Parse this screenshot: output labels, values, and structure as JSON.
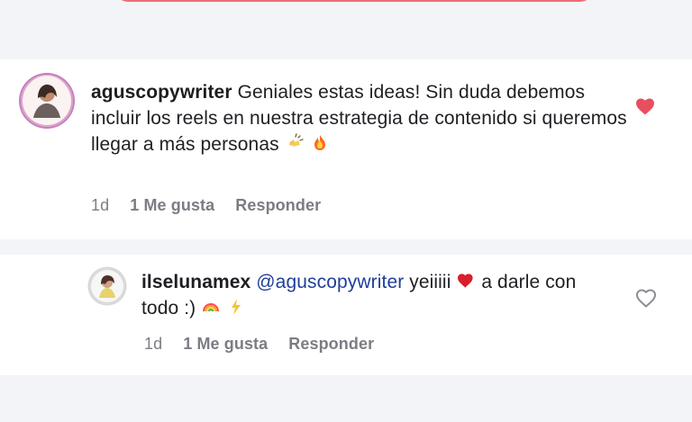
{
  "comments": {
    "main": {
      "username": "aguscopywriter",
      "text": "Geniales estas ideas! Sin duda debemos incluir los reels en nuestra estrategia de contenido si queremos llegar a más personas",
      "time": "1d",
      "likes": "1 Me gusta",
      "reply": "Responder"
    },
    "reply": {
      "username": "ilselunamex",
      "mention": "@aguscopywriter",
      "text_before_heart": "yeiiiii",
      "text_after_heart": "a darle con todo :)",
      "time": "1d",
      "likes": "1 Me gusta",
      "reply": "Responder"
    }
  },
  "colors": {
    "background": "#f3f4f8",
    "card": "#ffffff",
    "text": "#1f1f24",
    "muted": "#7c7c84",
    "mention": "#1f3f9a",
    "liked": "#e84f5e",
    "accent_pill": "#ef6a73"
  },
  "icons": {
    "main_heart": "heart-filled-icon",
    "reply_heart": "heart-outline-icon",
    "clap": "clapping-hands-icon",
    "fire": "fire-icon",
    "rainbow": "rainbow-icon",
    "lightning": "lightning-icon",
    "inline_heart": "red-heart-icon"
  }
}
